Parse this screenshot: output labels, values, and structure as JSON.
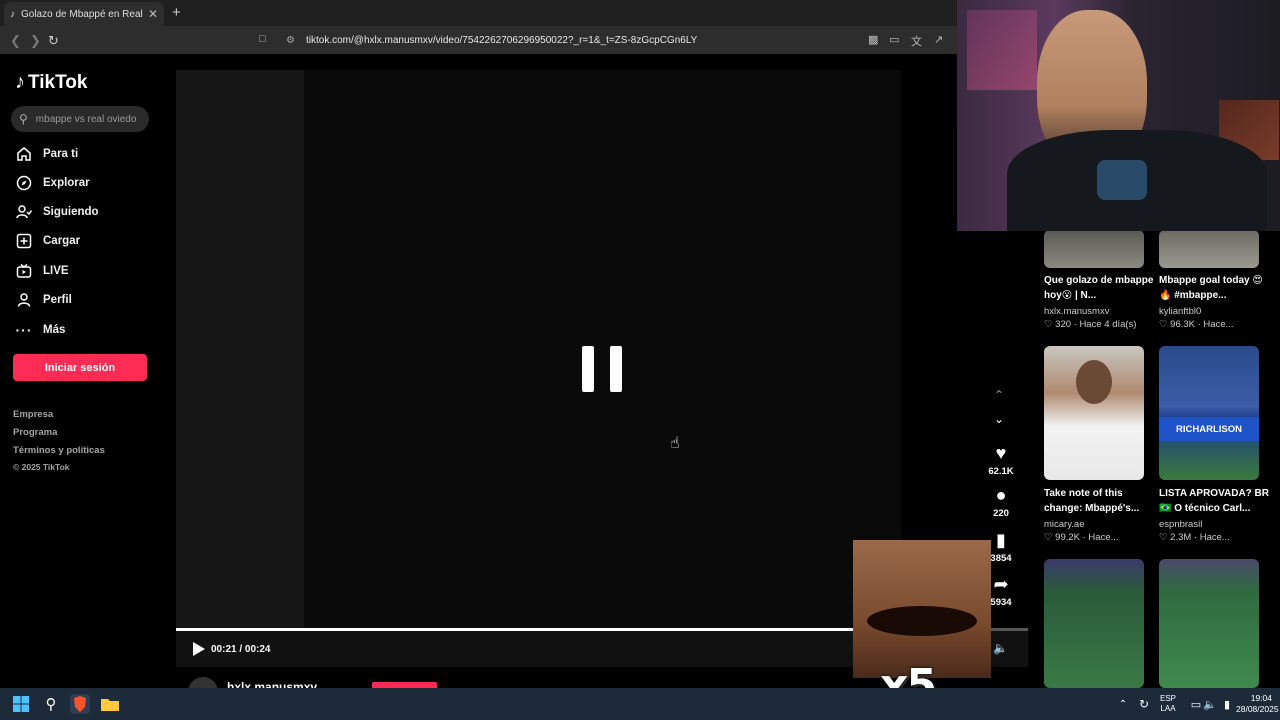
{
  "browser": {
    "tab_title": "Golazo de Mbappé en Real M",
    "tab_close": "✕",
    "new_tab": "+",
    "url": "tiktok.com/@hxlx.manusmxv/video/7542262706296950022?_r=1&_t=ZS-8zGcpCGn6LY"
  },
  "sidebar": {
    "logo": "TikTok",
    "search_placeholder": "mbappe vs real oviedo",
    "nav": [
      {
        "label": "Para ti",
        "icon": "home-icon"
      },
      {
        "label": "Explorar",
        "icon": "compass-icon"
      },
      {
        "label": "Siguiendo",
        "icon": "following-icon"
      },
      {
        "label": "Cargar",
        "icon": "upload-icon"
      },
      {
        "label": "LIVE",
        "icon": "live-icon"
      },
      {
        "label": "Perfil",
        "icon": "profile-icon"
      },
      {
        "label": "Más",
        "icon": "more-icon"
      }
    ],
    "login_button": "Iniciar sesión",
    "footer": [
      "Empresa",
      "Programa",
      "Términos y políticas",
      "© 2025 TikTok"
    ]
  },
  "video": {
    "time": "00:21 / 00:24",
    "progress": 0.8,
    "author": "hxlx.manusmxv"
  },
  "actions": {
    "likes": "62.1K",
    "comments": "220",
    "saves": "3854",
    "shares": "5934"
  },
  "recommendations": [
    {
      "title": "Que golazo de mbappe hoy😮 | N...",
      "author": "hxlx.manusmxv",
      "meta": "♡ 320 · Hace 4 día(s)"
    },
    {
      "title": "Mbappe goal today 😍🔥 #mbappe...",
      "author": "kylianftbl0",
      "meta": "♡ 96.3K · Hace..."
    },
    {
      "title": "Take note of this change: Mbappé's...",
      "author": "micary.ae",
      "meta": "♡ 99.2K · Hace..."
    },
    {
      "title": "LISTA APROVADA? BR🇧🇷 O técnico Carl...",
      "author": "espnbrasil",
      "meta": "♡ 2.3M · Hace..."
    }
  ],
  "overlay_text": "RICHARLISON",
  "meme_text": "x5",
  "taskbar": {
    "lang_top": "ESP",
    "lang_bottom": "LAA",
    "time": "19:04",
    "date": "28/08/2025"
  }
}
